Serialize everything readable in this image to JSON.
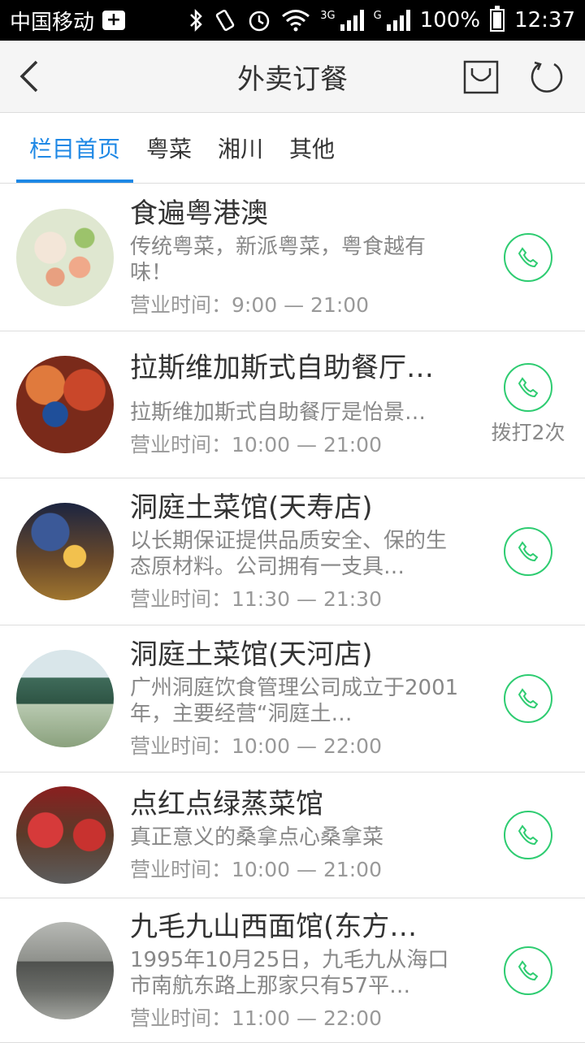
{
  "status_bar": {
    "carrier": "中国移动",
    "net1": "3G",
    "net2": "G",
    "battery": "100%",
    "time": "12:37"
  },
  "header": {
    "title": "外卖订餐"
  },
  "tabs": [
    {
      "label": "栏目首页",
      "active": true
    },
    {
      "label": "粤菜"
    },
    {
      "label": "湘川"
    },
    {
      "label": "其他"
    }
  ],
  "restaurants": [
    {
      "name": "食遍粤港澳",
      "desc": "传统粤菜，新派粤菜，粤食越有味！",
      "hours": "营业时间：9:00  —  21:00",
      "call_note": ""
    },
    {
      "name": "拉斯维加斯式自助餐厅…",
      "desc": "拉斯维加斯式自助餐厅是怡景…",
      "hours": "营业时间：10:00  —  21:00",
      "call_note": "拨打2次"
    },
    {
      "name": "洞庭土菜馆(天寿店)",
      "desc": "以长期保证提供品质安全、保的生态原材料。公司拥有一支具…",
      "hours": "营业时间：11:30  —  21:30",
      "call_note": ""
    },
    {
      "name": "洞庭土菜馆(天河店)",
      "desc": "广州洞庭饮食管理公司成立于2001年，主要经营“洞庭土…",
      "hours": "营业时间：10:00  —  22:00",
      "call_note": ""
    },
    {
      "name": "点红点绿蒸菜馆",
      "desc": "真正意义的桑拿点心桑拿菜",
      "hours": "营业时间：10:00  —  21:00",
      "call_note": ""
    },
    {
      "name": "九毛九山西面馆(东方…",
      "desc": "1995年10月25日，九毛九从海口市南航东路上那家只有57平…",
      "hours": "营业时间：11:00  —  22:00",
      "call_note": ""
    }
  ],
  "colors": {
    "accent": "#1e88e5",
    "call": "#2ecc71"
  }
}
